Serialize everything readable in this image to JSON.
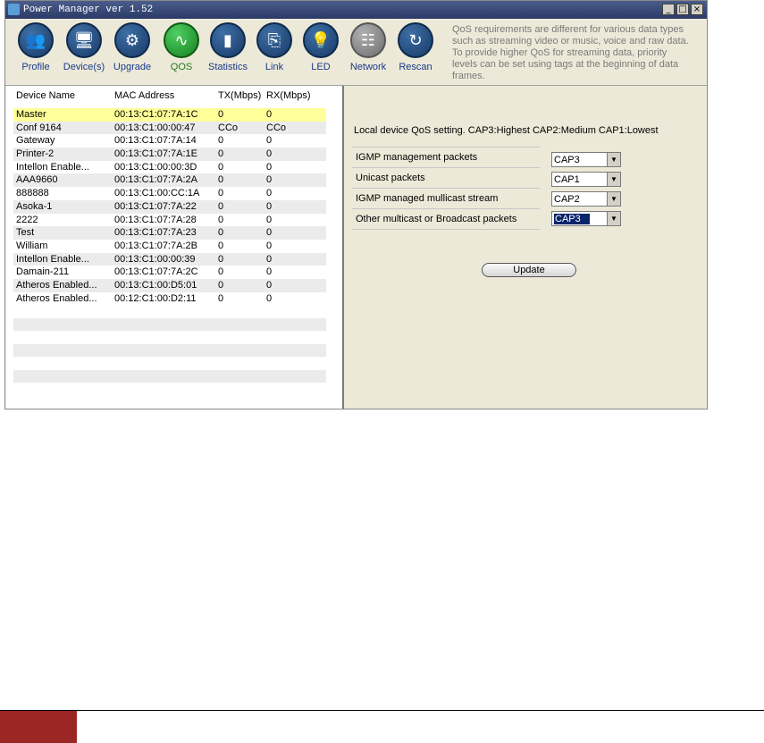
{
  "window": {
    "title": "Power Manager ver 1.52",
    "minimize_glyph": "_",
    "maximize_glyph": "□",
    "close_glyph": "×"
  },
  "toolbar": {
    "items": [
      {
        "label": "Profile",
        "icon": "profile-icon",
        "glyph": "👥"
      },
      {
        "label": "Device(s)",
        "icon": "devices-icon",
        "glyph": "🖥"
      },
      {
        "label": "Upgrade",
        "icon": "upgrade-icon",
        "glyph": "⚙"
      },
      {
        "label": "QOS",
        "icon": "qos-icon",
        "glyph": "∿"
      },
      {
        "label": "Statistics",
        "icon": "statistics-icon",
        "glyph": "▮"
      },
      {
        "label": "Link",
        "icon": "link-icon",
        "glyph": "⎘"
      },
      {
        "label": "LED",
        "icon": "led-icon",
        "glyph": "💡"
      },
      {
        "label": "Network",
        "icon": "network-icon",
        "glyph": "☷"
      },
      {
        "label": "Rescan",
        "icon": "rescan-icon",
        "glyph": "↻"
      }
    ],
    "active": "QOS"
  },
  "info_text": "QoS requirements are different for various data types such as streaming video or music, voice and raw data. To provide higher QoS for streaming data, priority levels can be set using tags at the beginning of data frames.",
  "device_table": {
    "headers": [
      "Device Name",
      "MAC Address",
      "TX(Mbps)",
      "RX(Mbps)"
    ],
    "rows": [
      {
        "name": "Master",
        "mac": "00:13:C1:07:7A:1C",
        "tx": "0",
        "rx": "0"
      },
      {
        "name": "Conf 9164",
        "mac": "00:13:C1:00:00:47",
        "tx": "CCo",
        "rx": "CCo"
      },
      {
        "name": "Gateway",
        "mac": "00:13:C1:07:7A:14",
        "tx": "0",
        "rx": "0"
      },
      {
        "name": "Printer-2",
        "mac": "00:13:C1:07:7A:1E",
        "tx": "0",
        "rx": "0"
      },
      {
        "name": "Intellon Enable...",
        "mac": "00:13:C1:00:00:3D",
        "tx": "0",
        "rx": "0"
      },
      {
        "name": "AAA9660",
        "mac": "00:13:C1:07:7A:2A",
        "tx": "0",
        "rx": "0"
      },
      {
        "name": "888888",
        "mac": "00:13:C1:00:CC:1A",
        "tx": "0",
        "rx": "0"
      },
      {
        "name": "Asoka-1",
        "mac": "00:13:C1:07:7A:22",
        "tx": "0",
        "rx": "0"
      },
      {
        "name": "2222",
        "mac": "00:13:C1:07:7A:28",
        "tx": "0",
        "rx": "0"
      },
      {
        "name": "Test",
        "mac": "00:13:C1:07:7A:23",
        "tx": "0",
        "rx": "0"
      },
      {
        "name": "William",
        "mac": "00:13:C1:07:7A:2B",
        "tx": "0",
        "rx": "0"
      },
      {
        "name": "Intellon Enable...",
        "mac": "00:13:C1:00:00:39",
        "tx": "0",
        "rx": "0"
      },
      {
        "name": "Damain-211",
        "mac": "00:13:C1:07:7A:2C",
        "tx": "0",
        "rx": "0"
      },
      {
        "name": "Atheros Enabled...",
        "mac": "00:13:C1:00:D5:01",
        "tx": "0",
        "rx": "0"
      },
      {
        "name": "Atheros Enabled...",
        "mac": "00:12:C1:00:D2:11",
        "tx": "0",
        "rx": "0"
      }
    ],
    "selected_index": 0
  },
  "qos": {
    "note": "Local device QoS setting. CAP3:Highest CAP2:Medium CAP1:Lowest",
    "rows": [
      {
        "label": "IGMP management packets",
        "value": "CAP3"
      },
      {
        "label": "Unicast packets",
        "value": "CAP1"
      },
      {
        "label": "IGMP managed mullicast stream",
        "value": "CAP2"
      },
      {
        "label": "Other multicast or Broadcast packets",
        "value": "CAP3"
      }
    ],
    "update_label": "Update"
  },
  "colors": {
    "selected_row": "#ffff99",
    "active_tool": "#16801f",
    "footer_accent": "#9b2724"
  }
}
